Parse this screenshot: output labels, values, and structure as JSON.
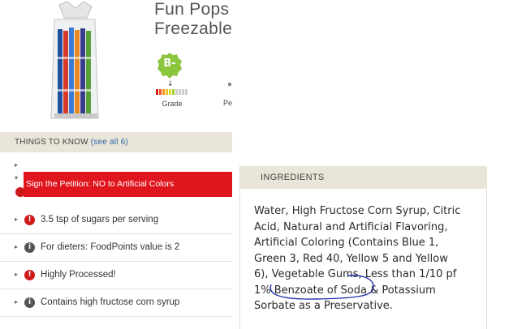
{
  "product": {
    "title_line1": "Fun Pops",
    "title_line2": "Freezable"
  },
  "grade": {
    "letter": "B-",
    "label": "Grade",
    "scale_colors": [
      "#d7191c",
      "#ef5a24",
      "#f59a22",
      "#f6c224",
      "#d9de3a",
      "#a7cf3a",
      "#cccccc",
      "#cccccc",
      "#cccccc",
      "#cccccc"
    ]
  },
  "next_label_partial": "Pe",
  "things_to_know": {
    "title": "THINGS TO KNOW",
    "see_all": "(see all 6)",
    "petition": "Sign the Petition: NO to Artificial Colors",
    "items": [
      {
        "icon": "warning-icon",
        "text": "3.5 tsp of sugars per serving"
      },
      {
        "icon": "info-icon",
        "text": "For dieters: FoodPoints value is 2"
      },
      {
        "icon": "warning-icon",
        "text": "Highly Processed!"
      },
      {
        "icon": "info-icon",
        "text": "Contains high fructose corn syrup"
      }
    ]
  },
  "ingredients": {
    "title": "INGREDIENTS",
    "lines": [
      "Water, High Fructose Corn Syrup, Citric",
      "Acid, Natural and Artificial Flavoring,",
      "Artificial Coloring (Contains Blue 1,",
      "Green 3, Red 40, Yellow 5 and Yellow",
      "6), Vegetable Gums, Less than 1/10 pf",
      "1% Benzoate of Soda & Potassium",
      "Sorbate as a Preservative."
    ]
  },
  "colors": {
    "petition_bg": "#e0161e",
    "header_bg": "#e9e5d8",
    "grade_green": "#8cc63f",
    "link_blue": "#2a62a8",
    "annotation_blue": "#2233aa"
  }
}
